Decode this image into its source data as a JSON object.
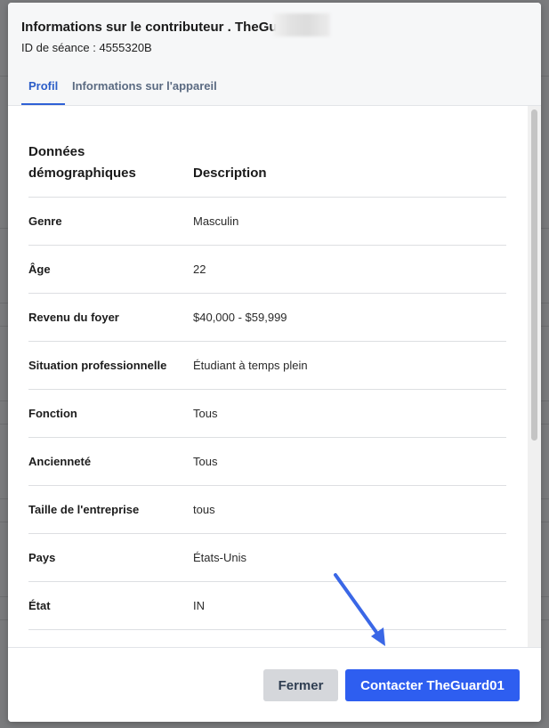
{
  "modal": {
    "title": "Informations sur le contributeur . TheGu",
    "session_id": "ID de séance : 4555320B",
    "tabs": [
      {
        "label": "Profil",
        "active": true
      },
      {
        "label": "Informations sur l'appareil",
        "active": false
      }
    ]
  },
  "table": {
    "headers": [
      "Données démographiques",
      "Description"
    ],
    "rows": [
      {
        "label": "Genre",
        "value": "Masculin"
      },
      {
        "label": "Âge",
        "value": "22"
      },
      {
        "label": "Revenu du foyer",
        "value": "$40,000 - $59,999"
      },
      {
        "label": "Situation professionnelle",
        "value": "Étudiant à temps plein"
      },
      {
        "label": "Fonction",
        "value": "Tous"
      },
      {
        "label": "Ancienneté",
        "value": "Tous"
      },
      {
        "label": "Taille de l'entreprise",
        "value": "tous"
      },
      {
        "label": "Pays",
        "value": "États-Unis"
      },
      {
        "label": "État",
        "value": "IN"
      }
    ]
  },
  "footer": {
    "close_label": "Fermer",
    "contact_label": "Contacter TheGuard01"
  },
  "colors": {
    "accent": "#2e5ef0",
    "annotation_arrow": "#3a67e6"
  }
}
